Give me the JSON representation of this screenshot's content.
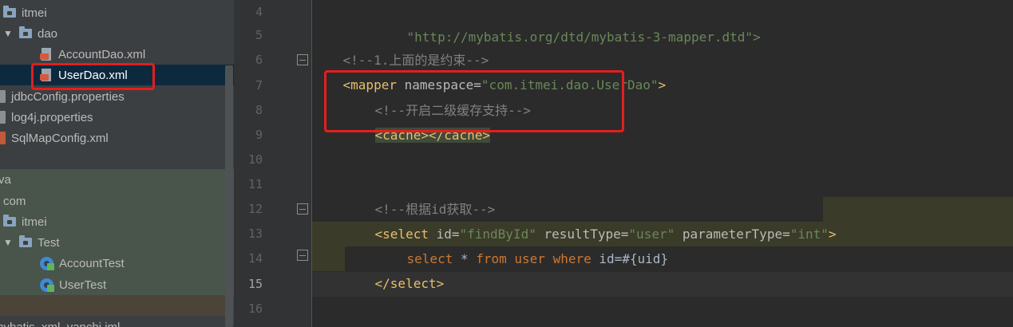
{
  "project_tree": {
    "items": [
      {
        "label": "itmei",
        "kind": "folder"
      },
      {
        "label": "dao",
        "kind": "folder-open"
      },
      {
        "label": "AccountDao.xml",
        "kind": "xml"
      },
      {
        "label": "UserDao.xml",
        "kind": "xml"
      },
      {
        "label": "jdbcConfig.properties",
        "kind": "properties"
      },
      {
        "label": "log4j.properties",
        "kind": "properties"
      },
      {
        "label": "SqlMapConfig.xml",
        "kind": "xml"
      },
      {
        "label": "va",
        "kind": "folder"
      },
      {
        "label": "com",
        "kind": "folder"
      },
      {
        "label": "itmei",
        "kind": "folder"
      },
      {
        "label": "Test",
        "kind": "folder-open"
      },
      {
        "label": "AccountTest",
        "kind": "class"
      },
      {
        "label": "UserTest",
        "kind": "class"
      },
      {
        "label": "mybatis_xml_yanchi.iml",
        "kind": "iml"
      }
    ],
    "colors": {
      "selected": "#0d293e",
      "test_zone": "#49544a",
      "highlight_box": "#e21f1f"
    }
  },
  "editor": {
    "line_numbers": [
      "4",
      "5",
      "6",
      "7",
      "8",
      "9",
      "10",
      "11",
      "12",
      "13",
      "14",
      "15",
      "16"
    ],
    "current_line": "15",
    "lines": {
      "l4_dtd": "\"http://mybatis.org/dtd/mybatis-3-mapper.dtd\">",
      "l5_comment": "<!--1.上面的是约束-->",
      "l6_open": "<mapper ",
      "l6_attr": "namespace=",
      "l6_val": "\"com.itmei.dao.UserDao\"",
      "l6_close": ">",
      "l7_comment": "<!--开启二级缓存支持-->",
      "l8_cache": "<cache></cache>",
      "l11_comment": "<!--根据id获取-->",
      "l12_open": "<select ",
      "l12_attr1": "id=",
      "l12_val1": "\"findById\"",
      "l12_attr2": " resultType=",
      "l12_val2": "\"user\"",
      "l12_attr3": " parameterType=",
      "l12_val3": "\"int\"",
      "l12_close": ">",
      "l13_kw1": "select",
      "l13_star": " * ",
      "l13_kw2": "from",
      "l13_tbl": " user ",
      "l13_kw3": "where",
      "l13_cond": " id=#{uid}",
      "l14_close": "</select>"
    },
    "colors": {
      "comment": "#808080",
      "tag": "#e8bf6a",
      "attr": "#bababa",
      "attr_value": "#6a8759",
      "sql_keyword": "#cc7832",
      "text": "#a9b7c6",
      "sql_highlight": "#3b3b2a",
      "current_line_bg": "#323232"
    }
  }
}
